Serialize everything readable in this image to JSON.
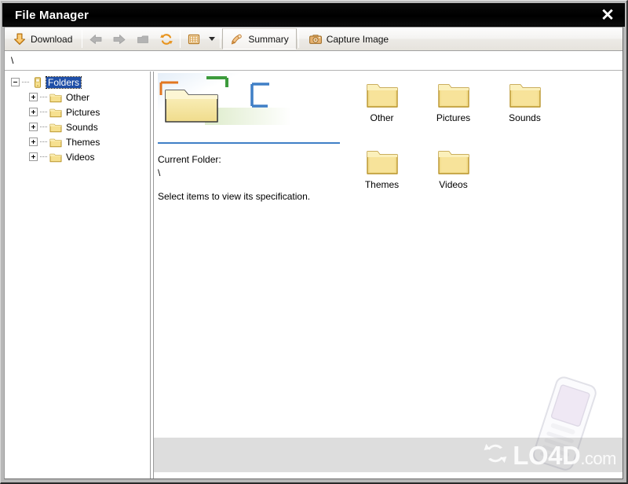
{
  "window": {
    "title": "File Manager",
    "close_label": "✕"
  },
  "toolbar": {
    "download_label": "Download",
    "back_icon": "back-arrow-icon",
    "forward_icon": "forward-arrow-icon",
    "up_icon": "up-folder-icon",
    "refresh_icon": "refresh-icon",
    "view_icon": "view-grid-icon",
    "view_caret": "chevron-down-icon",
    "summary_label": "Summary",
    "capture_label": "Capture Image"
  },
  "address": {
    "value": "\\",
    "placeholder": "\\"
  },
  "tree": {
    "root": {
      "label": "Folders",
      "expander": "minus",
      "icon": "device-icon",
      "selected": true
    },
    "children": [
      {
        "label": "Other",
        "expander": "plus",
        "icon": "folder-icon"
      },
      {
        "label": "Pictures",
        "expander": "plus",
        "icon": "folder-icon"
      },
      {
        "label": "Sounds",
        "expander": "plus",
        "icon": "folder-icon"
      },
      {
        "label": "Themes",
        "expander": "plus",
        "icon": "folder-icon"
      },
      {
        "label": "Videos",
        "expander": "plus",
        "icon": "folder-icon"
      }
    ]
  },
  "summary": {
    "banner_icon": "large-folder-banner",
    "current_folder_label": "Current Folder:",
    "current_folder_value": "\\",
    "hint": "Select items to view its specification."
  },
  "files": [
    {
      "name": "Other",
      "icon": "folder-icon"
    },
    {
      "name": "Pictures",
      "icon": "folder-icon"
    },
    {
      "name": "Sounds",
      "icon": "folder-icon"
    },
    {
      "name": "Themes",
      "icon": "folder-icon"
    },
    {
      "name": "Videos",
      "icon": "folder-icon"
    }
  ],
  "watermark": {
    "brand": "LO4D",
    "tld": ".com",
    "logo_icon": "recycle-arrows-icon",
    "phone_icon": "mobile-phone-icon"
  },
  "colors": {
    "titlebar": "#000000",
    "selection": "#1f4fa8",
    "rule": "#3f7fc6",
    "folder_body": "#f5dd85",
    "folder_edge": "#c9a227",
    "accent_orange": "#e8941f",
    "frame": "#b8b8b8"
  }
}
